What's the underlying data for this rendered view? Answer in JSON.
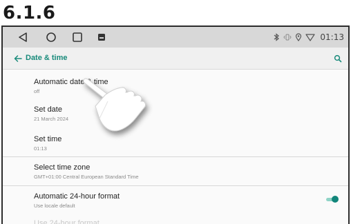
{
  "doc": {
    "heading": "6.1.6"
  },
  "navbar": {
    "back_icon": "triangle-back-icon",
    "home_icon": "circle-home-icon",
    "recents_icon": "square-recents-icon",
    "notification_icon": "image-notification-icon",
    "status_icons": [
      "bluetooth-icon",
      "vibrate-icon",
      "location-icon",
      "wifi-icon"
    ],
    "time": "01:13"
  },
  "appbar": {
    "title": "Date & time",
    "accent": "#188a7a"
  },
  "items": [
    {
      "title": "Automatic date & time",
      "subtitle": "off"
    },
    {
      "title": "Set date",
      "subtitle": "21 March 2024"
    },
    {
      "title": "Set time",
      "subtitle": "01:13"
    },
    {
      "title": "Select time zone",
      "subtitle": "GMT+01:00 Central European Standard Time"
    },
    {
      "title": "Automatic 24-hour format",
      "subtitle": "Use locale default",
      "toggle": "on"
    },
    {
      "title": "Use 24-hour format"
    }
  ],
  "overlay": {
    "icon": "pointing-hand-icon"
  }
}
